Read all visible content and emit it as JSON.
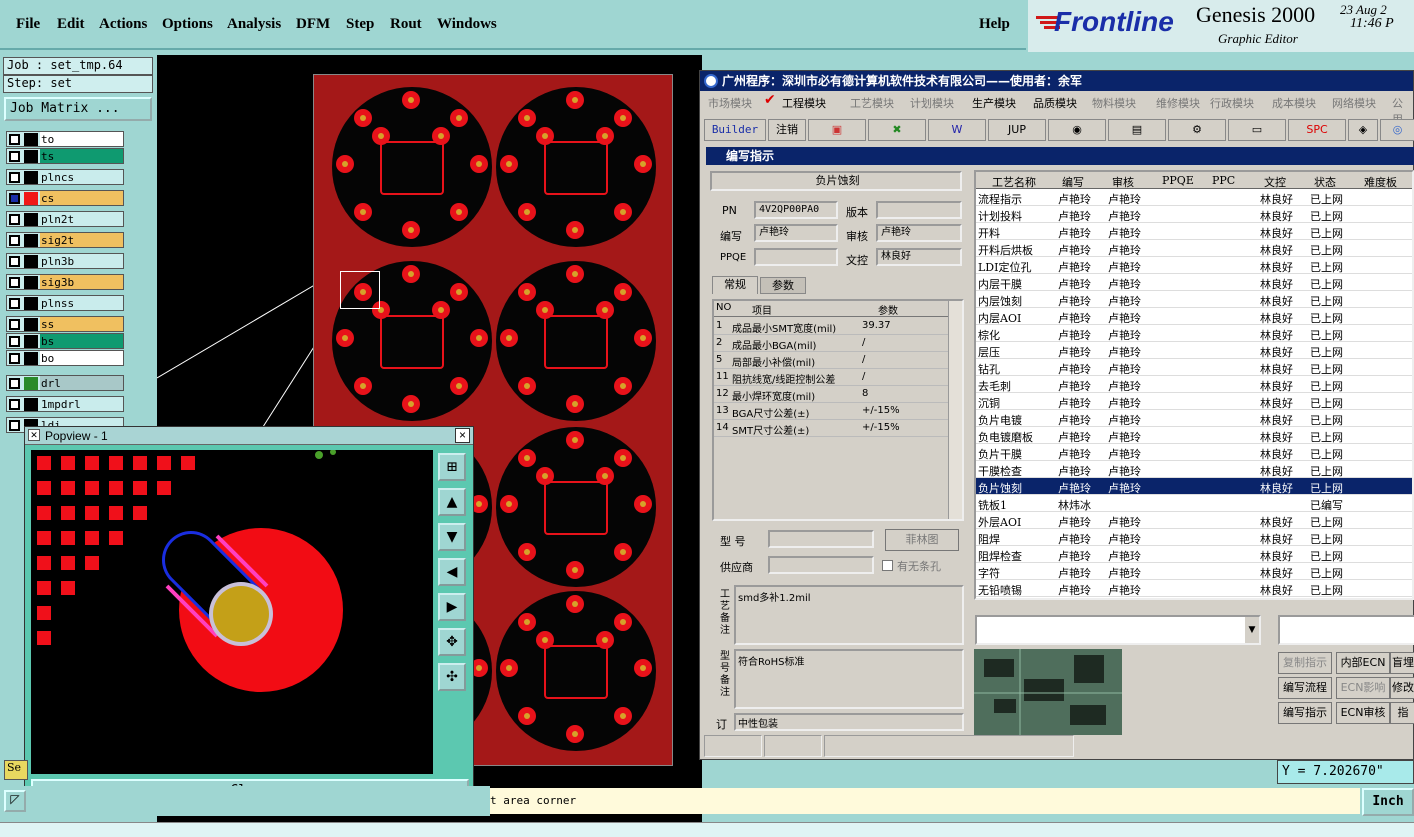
{
  "menu": {
    "file": "File",
    "edit": "Edit",
    "actions": "Actions",
    "options": "Options",
    "analysis": "Analysis",
    "dfm": "DFM",
    "step": "Step",
    "rout": "Rout",
    "windows": "Windows",
    "help": "Help"
  },
  "brand": {
    "logo": "Frontline",
    "product": "Genesis 2000",
    "subtitle": "Graphic Editor",
    "date": "23 Aug 2",
    "time": "11:46 P"
  },
  "job": {
    "job_label": "Job : set_tmp.64",
    "step_label": "Step: set",
    "matrix_button": "Job Matrix ..."
  },
  "layers": [
    "to",
    "ts",
    "plncs",
    "cs",
    "pln2t",
    "sig2t",
    "pln3b",
    "sig3b",
    "plnss",
    "ss",
    "bs",
    "bo",
    "drl",
    "1mpdrl",
    "ldi"
  ],
  "popview": {
    "title": "Popview - 1",
    "close": "Close"
  },
  "status": {
    "prompt": "t area corner",
    "coord": "Y = 7.202670\"",
    "unit": "Inch",
    "sel_tag": "Se"
  },
  "app": {
    "title": "广州程序：深圳市必有德计算机软件技术有限公司——使用者：余军",
    "modules": [
      "市场模块",
      "工程模块",
      "工艺模块",
      "计划模块",
      "生产模块",
      "品质模块",
      "物料模块",
      "维修模块",
      "行政模块",
      "成本模块",
      "网络模块",
      "公用"
    ],
    "toolbar": {
      "builder": "Builder",
      "logout": "注销",
      "jup": "JUP",
      "spc": "SPC"
    },
    "sub_title": "编写指示",
    "process_name": "负片蚀刻",
    "pn_label": "PN",
    "pn_value": "4V2QP00PA0",
    "version_label": "版本",
    "writer_label": "编写",
    "writer_value": "卢艳玲",
    "reviewer_label": "审核",
    "reviewer_value": "卢艳玲",
    "ppqe_label": "PPQE",
    "doc_label": "文控",
    "doc_value": "林良好",
    "tab_general": "常规",
    "tab_params": "参数",
    "param_headers": [
      "NO",
      "项目",
      "参数"
    ],
    "params": [
      [
        "1",
        "成品最小SMT宽度(mil)",
        "39.37"
      ],
      [
        "2",
        "成品最小BGA(mil)",
        "/"
      ],
      [
        "5",
        "局部最小补偿(mil)",
        "/"
      ],
      [
        "11",
        "阻抗线宽/线距控制公差",
        "/"
      ],
      [
        "12",
        "最小焊环宽度(mil)",
        "8"
      ],
      [
        "13",
        "BGA尺寸公差(±)",
        "+/-15%"
      ],
      [
        "14",
        "SMT尺寸公差(±)",
        "+/-15%"
      ]
    ],
    "model_label": "型  号",
    "supplier_label": "供应商",
    "film_btn": "菲林图",
    "no_strip_label": "有无条孔",
    "note1_label": "工艺备注",
    "note1": "smd多补1.2mil",
    "note2_label": "型号备注",
    "note2": "符合RoHS标准",
    "note3_label": "订",
    "note3": "中性包装",
    "grid_headers": [
      "工艺名称",
      "编写",
      "审核",
      "PPQE",
      "PPC",
      "文控",
      "状态",
      "难度板"
    ],
    "grid_rows": [
      [
        "流程指示",
        "卢艳玲",
        "卢艳玲",
        "",
        "",
        "林良好",
        "已上网"
      ],
      [
        "计划投料",
        "卢艳玲",
        "卢艳玲",
        "",
        "",
        "林良好",
        "已上网"
      ],
      [
        "开料",
        "卢艳玲",
        "卢艳玲",
        "",
        "",
        "林良好",
        "已上网"
      ],
      [
        "开料后烘板",
        "卢艳玲",
        "卢艳玲",
        "",
        "",
        "林良好",
        "已上网"
      ],
      [
        "LDI定位孔",
        "卢艳玲",
        "卢艳玲",
        "",
        "",
        "林良好",
        "已上网"
      ],
      [
        "内层干膜",
        "卢艳玲",
        "卢艳玲",
        "",
        "",
        "林良好",
        "已上网"
      ],
      [
        "内层蚀刻",
        "卢艳玲",
        "卢艳玲",
        "",
        "",
        "林良好",
        "已上网"
      ],
      [
        "内层AOI",
        "卢艳玲",
        "卢艳玲",
        "",
        "",
        "林良好",
        "已上网"
      ],
      [
        "棕化",
        "卢艳玲",
        "卢艳玲",
        "",
        "",
        "林良好",
        "已上网"
      ],
      [
        "层压",
        "卢艳玲",
        "卢艳玲",
        "",
        "",
        "林良好",
        "已上网"
      ],
      [
        "钻孔",
        "卢艳玲",
        "卢艳玲",
        "",
        "",
        "林良好",
        "已上网"
      ],
      [
        "去毛刺",
        "卢艳玲",
        "卢艳玲",
        "",
        "",
        "林良好",
        "已上网"
      ],
      [
        "沉铜",
        "卢艳玲",
        "卢艳玲",
        "",
        "",
        "林良好",
        "已上网"
      ],
      [
        "负片电镀",
        "卢艳玲",
        "卢艳玲",
        "",
        "",
        "林良好",
        "已上网"
      ],
      [
        "负电镀磨板",
        "卢艳玲",
        "卢艳玲",
        "",
        "",
        "林良好",
        "已上网"
      ],
      [
        "负片干膜",
        "卢艳玲",
        "卢艳玲",
        "",
        "",
        "林良好",
        "已上网"
      ],
      [
        "干膜检查",
        "卢艳玲",
        "卢艳玲",
        "",
        "",
        "林良好",
        "已上网"
      ],
      [
        "负片蚀刻",
        "卢艳玲",
        "卢艳玲",
        "",
        "",
        "林良好",
        "已上网"
      ],
      [
        "铣板1",
        "林炜冰",
        "",
        "",
        "",
        "",
        "已编写"
      ],
      [
        "外层AOI",
        "卢艳玲",
        "卢艳玲",
        "",
        "",
        "林良好",
        "已上网"
      ],
      [
        "阻焊",
        "卢艳玲",
        "卢艳玲",
        "",
        "",
        "林良好",
        "已上网"
      ],
      [
        "阻焊检查",
        "卢艳玲",
        "卢艳玲",
        "",
        "",
        "林良好",
        "已上网"
      ],
      [
        "字符",
        "卢艳玲",
        "卢艳玲",
        "",
        "",
        "林良好",
        "已上网"
      ],
      [
        "无铅喷锡",
        "卢艳玲",
        "卢艳玲",
        "",
        "",
        "林良好",
        "已上网"
      ]
    ],
    "buttons": [
      "复制指示",
      "内部ECN",
      "盲埋",
      "编写流程",
      "ECN影响",
      "修改",
      "编写指示",
      "ECN审核",
      "指"
    ]
  }
}
